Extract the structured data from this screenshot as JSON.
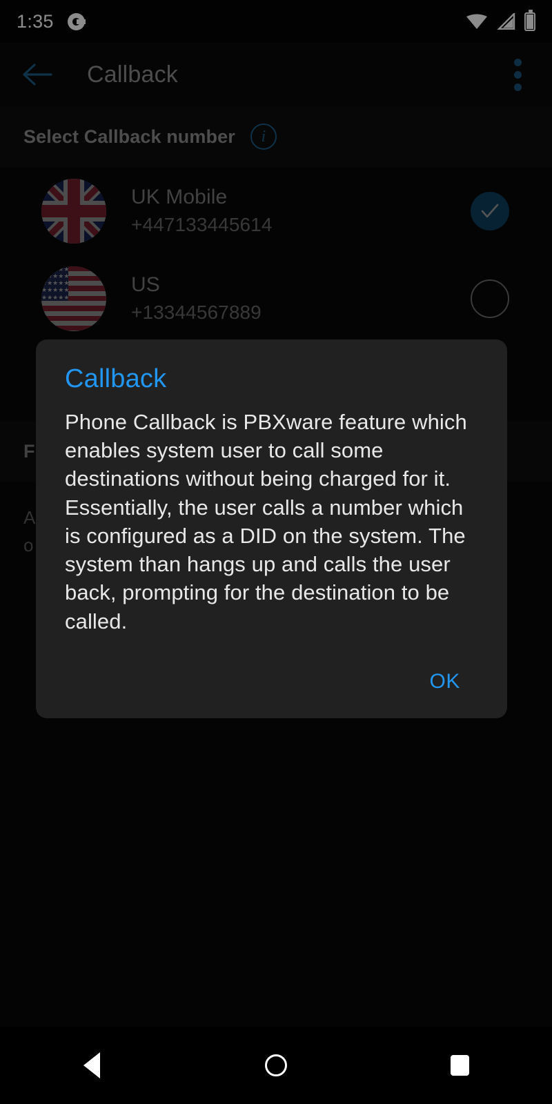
{
  "status_bar": {
    "time": "1:35",
    "notification_icon": "g-notification-icon",
    "wifi_icon": "wifi-icon",
    "signal_icon": "cellular-signal-icon",
    "battery_icon": "battery-icon"
  },
  "app_bar": {
    "back_icon": "back-arrow-icon",
    "title": "Callback",
    "overflow_icon": "overflow-menu-icon",
    "accent_color": "#1d5c85",
    "title_color": "#8c8c8c"
  },
  "section": {
    "title": "Select Callback number",
    "info_icon_label": "i"
  },
  "numbers": [
    {
      "name": "UK Mobile",
      "number": "+447133445614",
      "flag": "uk-flag",
      "selected": true,
      "check_icon": "check-icon"
    },
    {
      "name": "US",
      "number": "+13344567889",
      "flag": "us-flag",
      "selected": false,
      "check_icon": ""
    }
  ],
  "background_content": {
    "section_title": "F",
    "line_one": "A",
    "line_two": "o"
  },
  "dialog": {
    "title": "Callback",
    "message": "Phone Callback is PBXware feature which enables system user to call some destinations without being charged for it. Essentially, the user calls a number which is configured as a DID on the system. The system than hangs up and calls the user back, prompting for the destination to be called.",
    "ok_label": "OK",
    "title_color": "#2196f3",
    "background_color": "#212121"
  },
  "nav_bar": {
    "back_icon": "nav-back-icon",
    "home_icon": "nav-home-icon",
    "recents_icon": "nav-recents-icon"
  }
}
